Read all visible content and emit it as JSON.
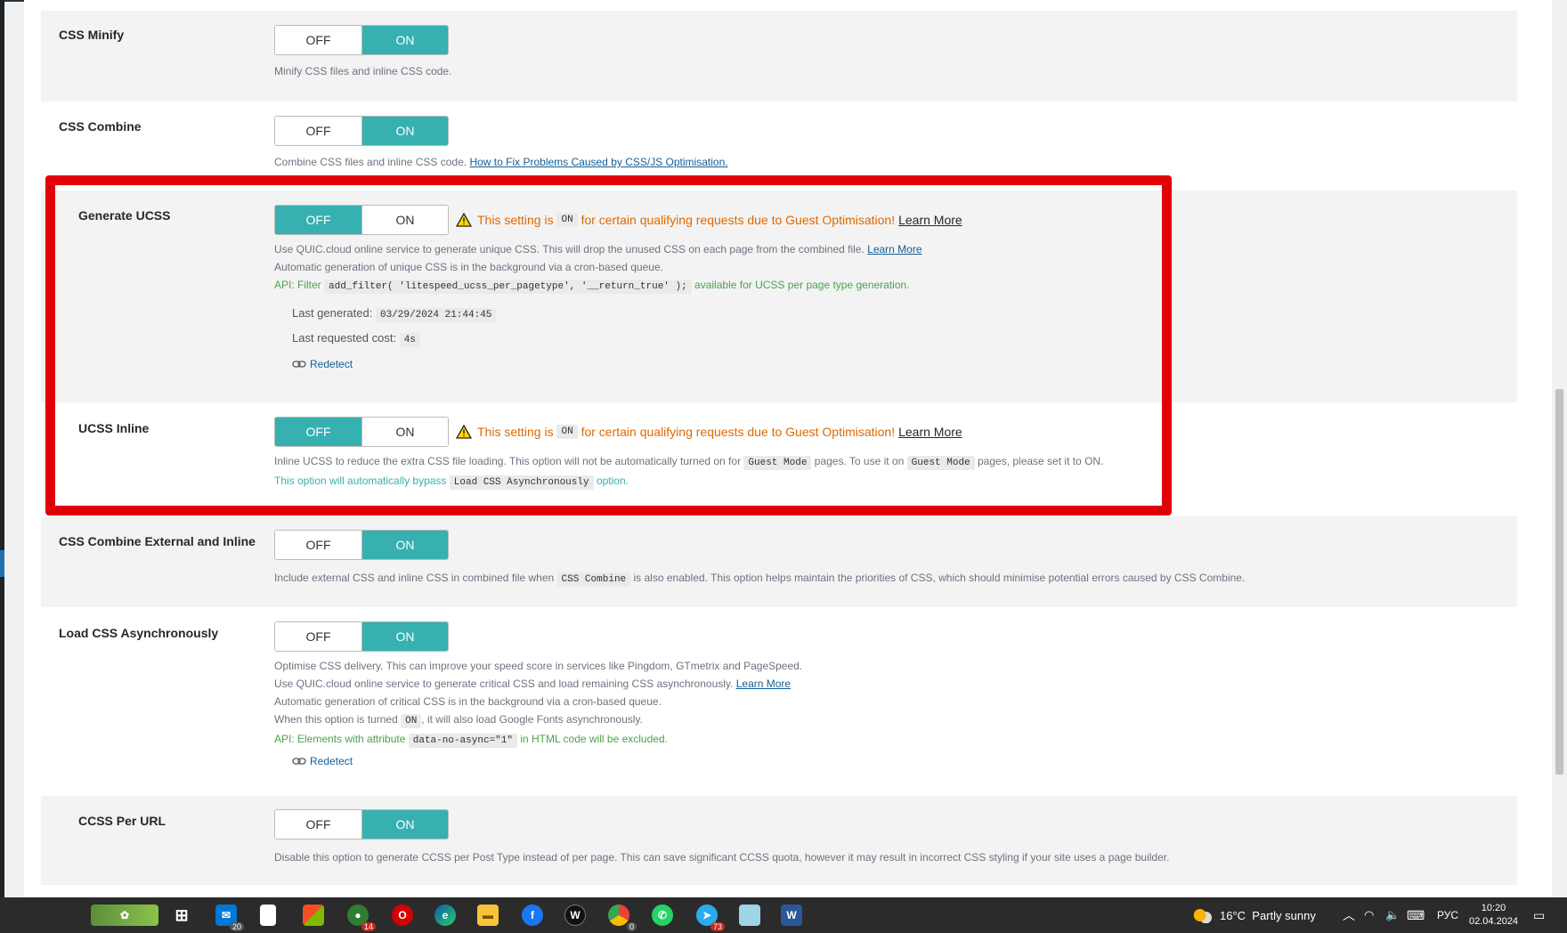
{
  "toggle": {
    "off": "OFF",
    "on": "ON"
  },
  "settings": {
    "css_minify": {
      "label": "CSS Minify",
      "desc": "Minify CSS files and inline CSS code.",
      "value": "ON"
    },
    "css_combine": {
      "label": "CSS Combine",
      "desc": "Combine CSS files and inline CSS code.",
      "link": "How to Fix Problems Caused by CSS/JS Optimisation.",
      "value": "ON"
    },
    "generate_ucss": {
      "label": "Generate UCSS",
      "value": "OFF",
      "warning_pre": "This setting is",
      "warning_code": "ON",
      "warning_post": "for certain qualifying requests due to Guest Optimisation!",
      "warning_link": "Learn More",
      "desc1": "Use QUIC.cloud online service to generate unique CSS. This will drop the unused CSS on each page from the combined file.",
      "desc1_link": "Learn More",
      "desc2": "Automatic generation of unique CSS is in the background via a cron-based queue.",
      "api_pre": "API: Filter",
      "api_code": "add_filter( 'litespeed_ucss_per_pagetype', '__return_true' );",
      "api_post": "available for UCSS per page type generation.",
      "last_generated_label": "Last generated:",
      "last_generated_value": "03/29/2024 21:44:45",
      "last_cost_label": "Last requested cost:",
      "last_cost_value": "4s",
      "redetect": "Redetect"
    },
    "ucss_inline": {
      "label": "UCSS Inline",
      "value": "OFF",
      "warning_pre": "This setting is",
      "warning_code": "ON",
      "warning_post": "for certain qualifying requests due to Guest Optimisation!",
      "warning_link": "Learn More",
      "desc_pre": "Inline UCSS to reduce the extra CSS file loading. This option will not be automatically turned on for",
      "desc_code1": "Guest Mode",
      "desc_mid": "pages. To use it on",
      "desc_code2": "Guest Mode",
      "desc_post": "pages, please set it to ON.",
      "note_pre": "This option will automatically bypass",
      "note_code": "Load CSS Asynchronously",
      "note_post": "option."
    },
    "css_combine_ext": {
      "label": "CSS Combine External and Inline",
      "value": "ON",
      "desc_pre": "Include external CSS and inline CSS in combined file when",
      "desc_code": "CSS Combine",
      "desc_post": "is also enabled. This option helps maintain the priorities of CSS, which should minimise potential errors caused by CSS Combine."
    },
    "load_css_async": {
      "label": "Load CSS Asynchronously",
      "value": "ON",
      "desc1": "Optimise CSS delivery. This can improve your speed score in services like Pingdom, GTmetrix and PageSpeed.",
      "desc2": "Use QUIC.cloud online service to generate critical CSS and load remaining CSS asynchronously.",
      "desc2_link": "Learn More",
      "desc3": "Automatic generation of critical CSS is in the background via a cron-based queue.",
      "desc4_pre": "When this option is turned",
      "desc4_code": "ON",
      "desc4_post": ", it will also load Google Fonts asynchronously.",
      "api_pre": "API: Elements with attribute",
      "api_code": "data-no-async=\"1\"",
      "api_post": "in HTML code will be excluded.",
      "redetect": "Redetect"
    },
    "ccss_per_url": {
      "label": "CCSS Per URL",
      "value": "ON",
      "desc": "Disable this option to generate CCSS per Post Type instead of per page. This can save significant CCSS quota, however it may result in incorrect CSS styling if your site uses a page builder."
    }
  },
  "taskbar": {
    "mail_badge": "20",
    "app_badge": "14",
    "chrome_badge": "0",
    "telegram_badge": "73",
    "weather": "16°C",
    "weather_desc": "Partly sunny",
    "language": "РУС",
    "time": "10:20",
    "date": "02.04.2024"
  },
  "colors": {
    "toggle_active": "#36b0b0",
    "warning": "#dd6900",
    "highlight_border": "#e1000a",
    "api_green": "#4ca24c"
  }
}
